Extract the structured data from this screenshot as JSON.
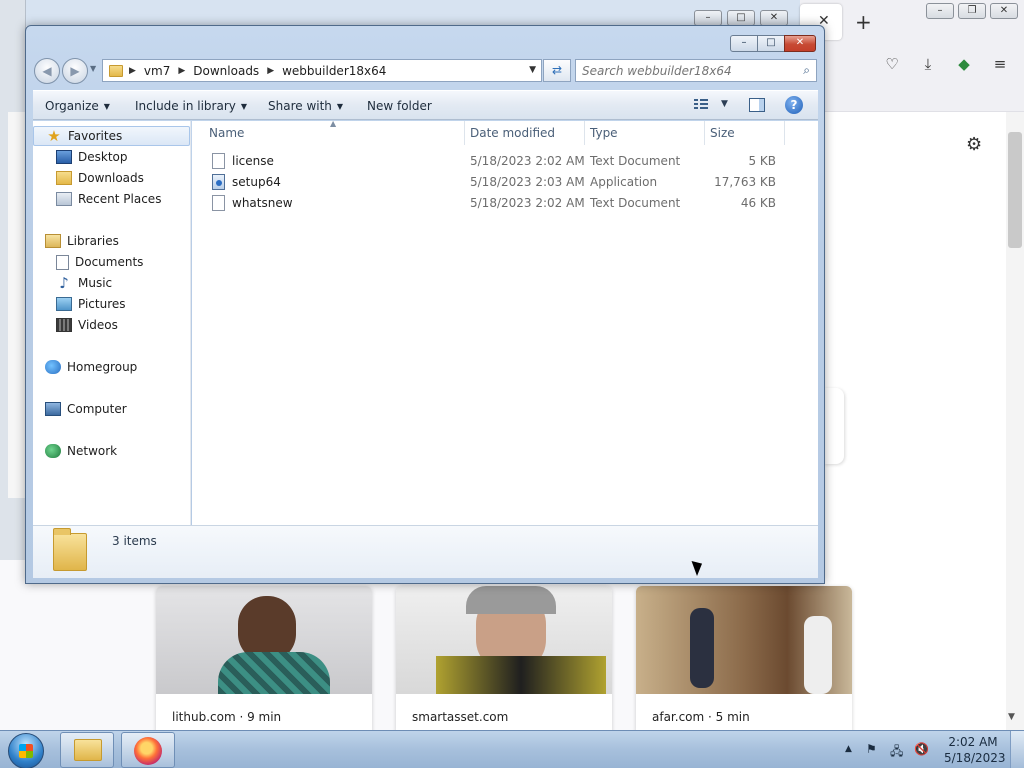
{
  "browser": {
    "tab_close_glyph": "✕",
    "new_tab_glyph": "+",
    "window_buttons": [
      "–",
      "❐",
      "✕"
    ],
    "bg_window_buttons": [
      "–",
      "□",
      "✕"
    ],
    "toolbar_icons": [
      "pocket-icon",
      "download-icon",
      "extension-icon",
      "menu-icon"
    ],
    "settings_glyph": "⚙",
    "cards": [
      {
        "source": "lithub.com · 9 min"
      },
      {
        "source": "smartasset.com"
      },
      {
        "source": "afar.com · 5 min"
      }
    ]
  },
  "explorer": {
    "window_buttons": {
      "minimize": "–",
      "maximize": "□",
      "close": "✕"
    },
    "breadcrumb": [
      "vm7",
      "Downloads",
      "webbuilder18x64"
    ],
    "search_placeholder": "Search webbuilder18x64",
    "toolbar": {
      "organize": "Organize",
      "include_in_library": "Include in library",
      "share_with": "Share with",
      "new_folder": "New folder"
    },
    "nav": {
      "favorites": "Favorites",
      "desktop": "Desktop",
      "downloads": "Downloads",
      "recent_places": "Recent Places",
      "libraries": "Libraries",
      "documents": "Documents",
      "music": "Music",
      "pictures": "Pictures",
      "videos": "Videos",
      "homegroup": "Homegroup",
      "computer": "Computer",
      "network": "Network"
    },
    "columns": {
      "name": "Name",
      "date_modified": "Date modified",
      "type": "Type",
      "size": "Size"
    },
    "files": [
      {
        "name": "license",
        "date": "5/18/2023 2:02 AM",
        "type": "Text Document",
        "size": "5 KB"
      },
      {
        "name": "setup64",
        "date": "5/18/2023 2:03 AM",
        "type": "Application",
        "size": "17,763 KB"
      },
      {
        "name": "whatsnew",
        "date": "5/18/2023 2:02 AM",
        "type": "Text Document",
        "size": "46 KB"
      }
    ],
    "status": {
      "item_count": "3 items"
    }
  },
  "taskbar": {
    "time": "2:02 AM",
    "date": "5/18/2023",
    "tray_glyphs": [
      "▲",
      "⚑",
      "🖧",
      "🔇"
    ]
  }
}
